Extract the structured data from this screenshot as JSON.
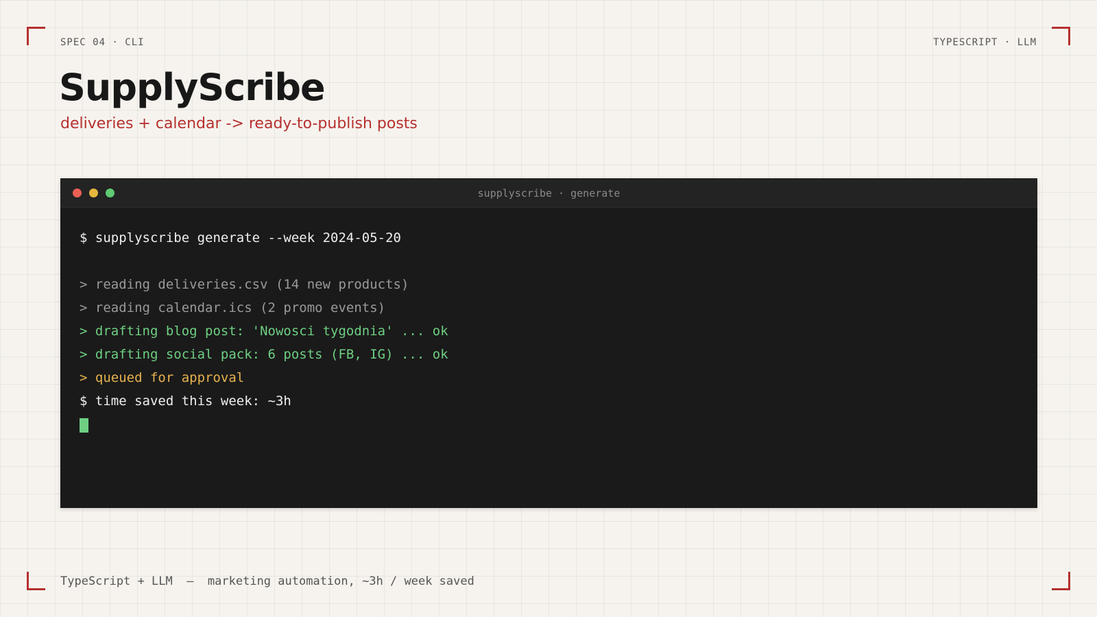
{
  "header": {
    "left_label": "SPEC 04 · CLI",
    "right_label": "TYPESCRIPT · LLM",
    "title": "SupplyScribe",
    "subtitle": "deliveries + calendar -> ready-to-publish posts"
  },
  "terminal": {
    "window_title": "supplyscribe · generate",
    "lines": [
      {
        "text": "$ supplyscribe generate --week 2024-05-20",
        "color": "#efefef"
      },
      {
        "text": "",
        "color": "#efefef"
      },
      {
        "text": "> reading deliveries.csv (14 new products)",
        "color": "#9a9a9a"
      },
      {
        "text": "> reading calendar.ics (2 promo events)",
        "color": "#9a9a9a"
      },
      {
        "text": "> drafting blog post: 'Nowosci tygodnia' ... ok",
        "color": "#6ecf82"
      },
      {
        "text": "> drafting social pack: 6 posts (FB, IG) ... ok",
        "color": "#6ecf82"
      },
      {
        "text": "> queued for approval",
        "color": "#e6b24e"
      },
      {
        "text": "$ time saved this week: ~3h",
        "color": "#efefef"
      }
    ],
    "traffic_lights": {
      "close": "#ec5f55",
      "minimize": "#e6b73e",
      "maximize": "#5fcb72"
    }
  },
  "footer": {
    "text": "TypeScript + LLM  —  marketing automation, ~3h / week saved"
  },
  "colors": {
    "accent": "#b5302e",
    "background": "#f6f3ee",
    "terminal_bg": "#1a1a1a"
  }
}
